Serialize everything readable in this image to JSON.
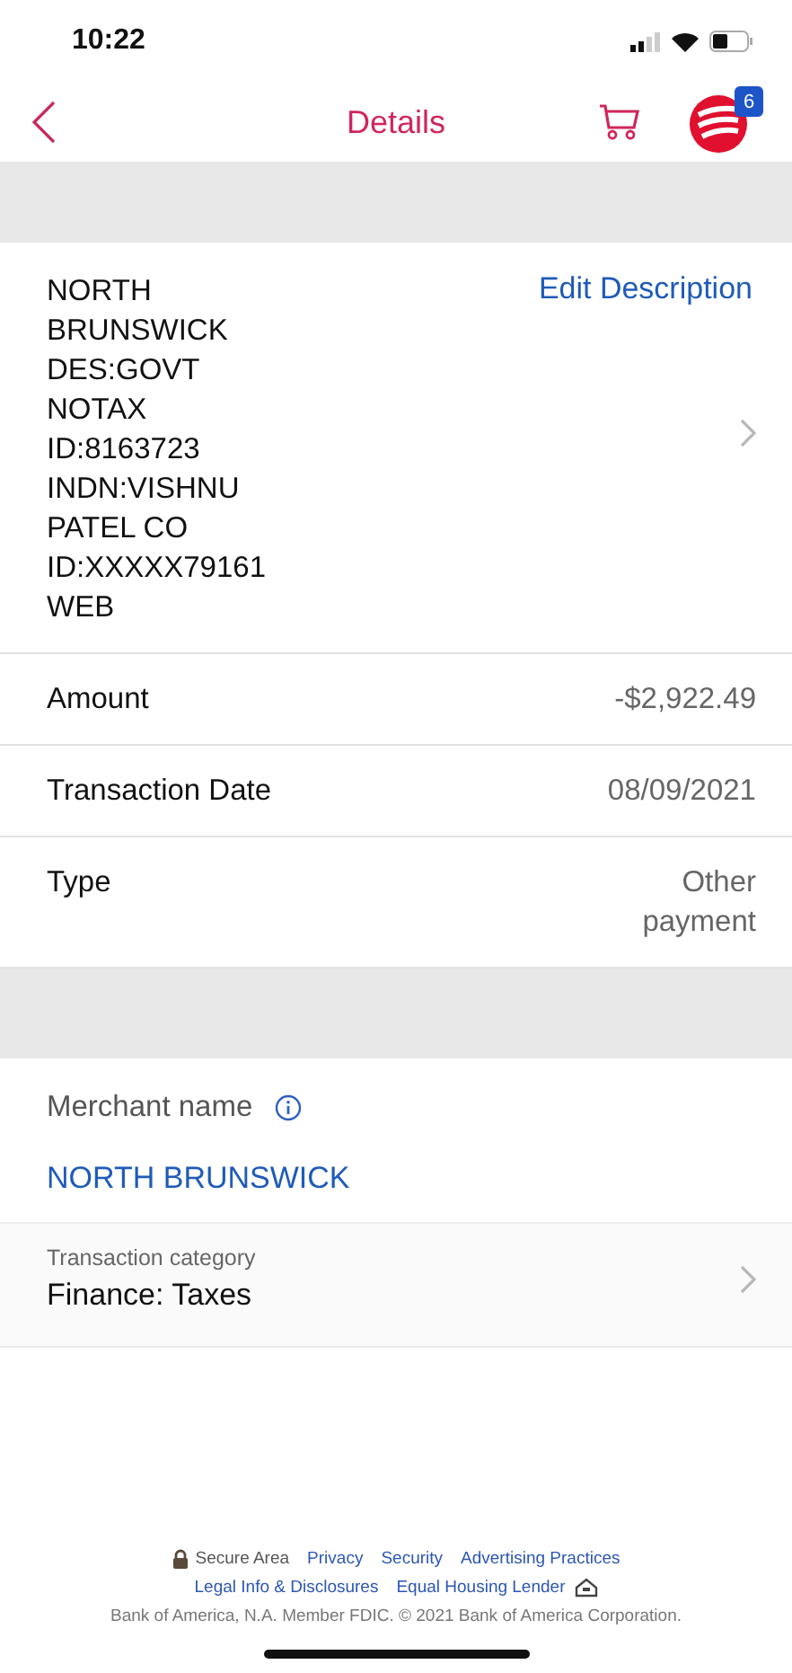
{
  "status_bar": {
    "time": "10:22"
  },
  "nav": {
    "title": "Details",
    "badge": "6"
  },
  "description": {
    "text": "NORTH BRUNSWICK DES:GOVT NOTAX ID:8163723 INDN:VISHNU PATEL CO ID:XXXXX79161 WEB",
    "action": "Edit Description"
  },
  "details": [
    {
      "label": "Amount",
      "value": "-$2,922.49"
    },
    {
      "label": "Transaction Date",
      "value": "08/09/2021"
    },
    {
      "label": "Type",
      "value": "Other payment"
    }
  ],
  "merchant": {
    "label": "Merchant name",
    "name": "NORTH BRUNSWICK"
  },
  "category": {
    "label": "Transaction category",
    "value": "Finance: Taxes"
  },
  "footer": {
    "line1": [
      {
        "kind": "secure",
        "text": "Secure Area"
      },
      {
        "kind": "link",
        "text": "Privacy"
      },
      {
        "kind": "link",
        "text": "Security"
      },
      {
        "kind": "link",
        "text": "Advertising Practices"
      }
    ],
    "line2": [
      {
        "kind": "link",
        "text": "Legal Info & Disclosures"
      },
      {
        "kind": "housing",
        "text": "Equal Housing Lender"
      }
    ],
    "copyright": "Bank of America, N.A. Member FDIC. © 2021 Bank of America Corporation."
  }
}
